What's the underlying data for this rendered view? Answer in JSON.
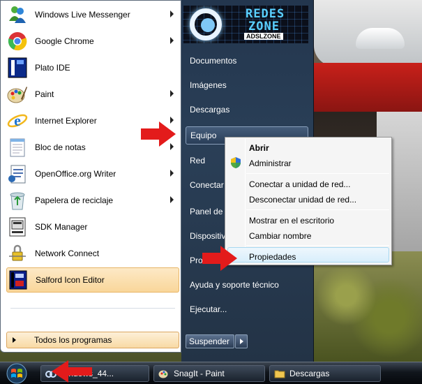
{
  "colors": {
    "accent_red": "#e31b1b",
    "selected_program_bg": "#f9d69a",
    "right_pane_bg": "#2a3f57",
    "context_highlight": "#d8eefb"
  },
  "programs": [
    {
      "label": "Windows Live Messenger",
      "icon": "messenger-icon",
      "has_submenu": true
    },
    {
      "label": "Google Chrome",
      "icon": "chrome-icon",
      "has_submenu": true
    },
    {
      "label": "Plato IDE",
      "icon": "plato-ide-icon",
      "has_submenu": false
    },
    {
      "label": "Paint",
      "icon": "paint-icon",
      "has_submenu": true
    },
    {
      "label": "Internet Explorer",
      "icon": "internet-explorer-icon",
      "has_submenu": true
    },
    {
      "label": "Bloc de notas",
      "icon": "notepad-icon",
      "has_submenu": true
    },
    {
      "label": "OpenOffice.org Writer",
      "icon": "openoffice-writer-icon",
      "has_submenu": true
    },
    {
      "label": "Papelera de reciclaje",
      "icon": "recycle-bin-icon",
      "has_submenu": true
    },
    {
      "label": "SDK Manager",
      "icon": "sdk-manager-icon",
      "has_submenu": false
    },
    {
      "label": "Network Connect",
      "icon": "network-connect-icon",
      "has_submenu": false
    },
    {
      "label": "Salford Icon Editor",
      "icon": "salford-icon-editor-icon",
      "has_submenu": false,
      "selected": true
    }
  ],
  "all_programs": "Todos los programas",
  "banner": {
    "line1": "REDES",
    "line2": "ZONE",
    "line3": "ADSLZONE"
  },
  "right_items": {
    "documents": "Documentos",
    "images": "Imágenes",
    "downloads": "Descargas",
    "computer": "Equipo",
    "network": "Red",
    "connect": "Conectar",
    "control_panel": "Panel de c",
    "devices": "Dispositiv",
    "programs": "Pro",
    "help": "Ayuda y soporte técnico",
    "run": "Ejecutar..."
  },
  "suspend_label": "Suspender",
  "context_menu": {
    "open": "Abrir",
    "manage": "Administrar",
    "map_drive": "Conectar a unidad de red...",
    "disconnect_drive": "Desconectar unidad de red...",
    "show_desktop": "Mostrar en el escritorio",
    "rename": "Cambiar nombre",
    "properties": "Propiedades"
  },
  "taskbar": {
    "buttons": [
      {
        "label": "windows_44...",
        "icon": "image-viewer-icon"
      },
      {
        "label": "SnagIt - Paint",
        "icon": "paint-icon"
      },
      {
        "label": "Descargas",
        "icon": "folder-icon"
      }
    ]
  }
}
